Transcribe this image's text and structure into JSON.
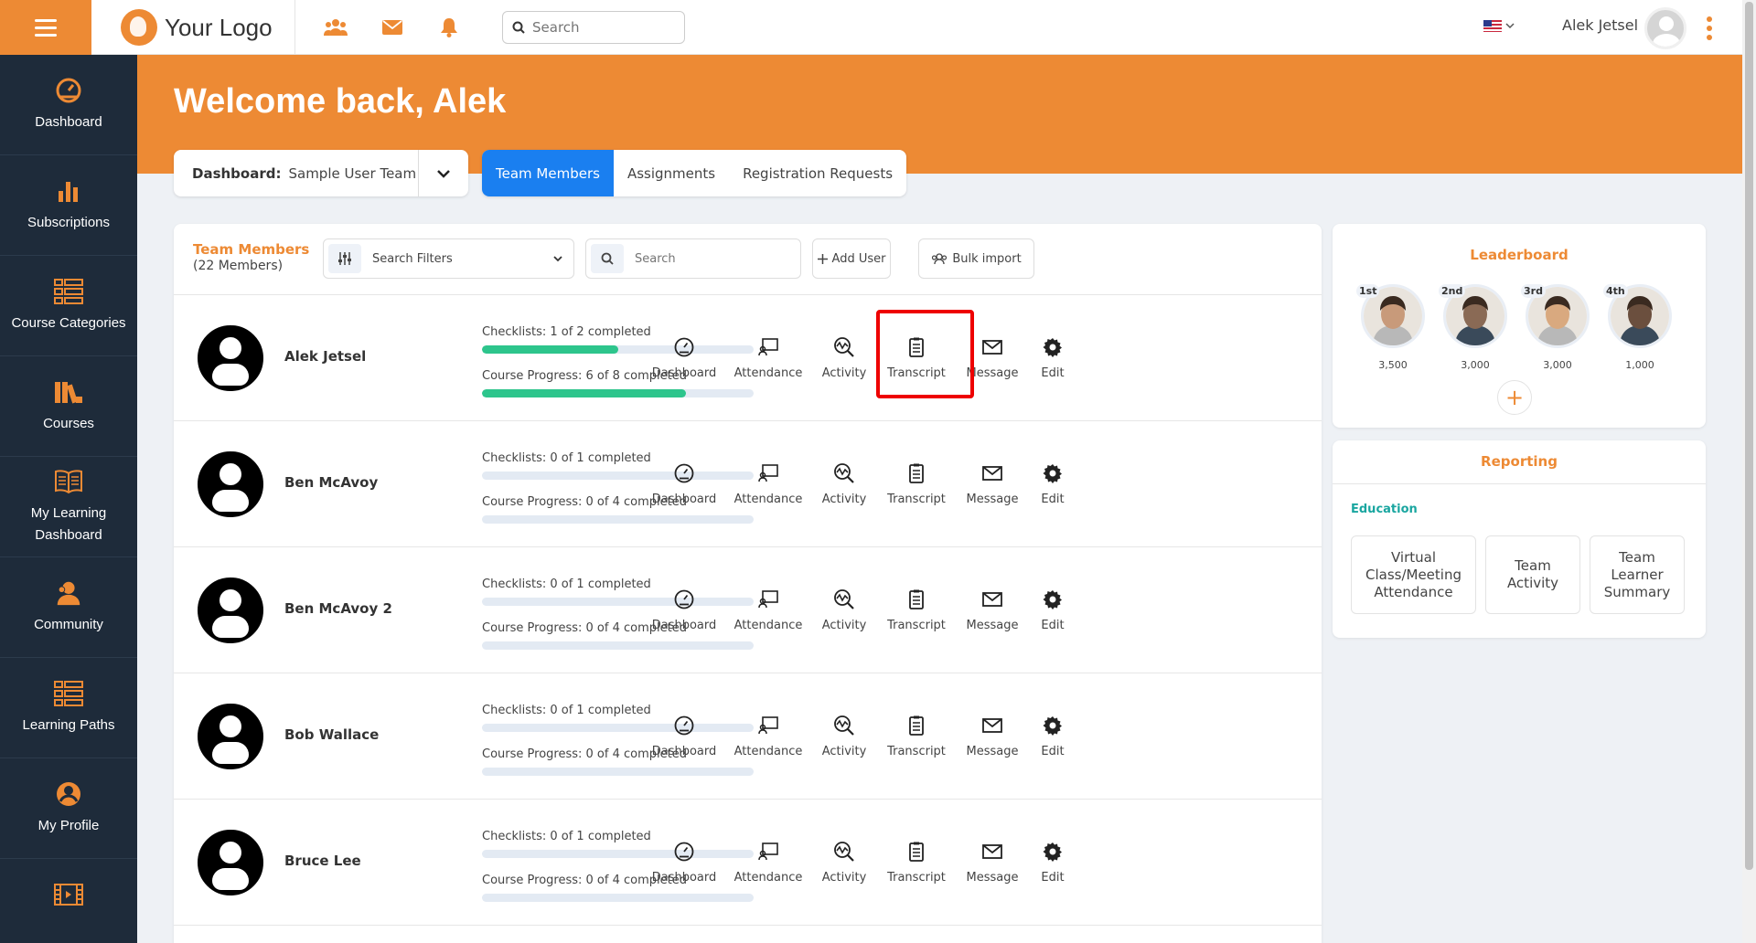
{
  "topbar": {
    "logo_text": "Your Logo",
    "search_placeholder": "Search",
    "user_name": "Alek Jetsel"
  },
  "sidebar": {
    "items": [
      {
        "label": "Dashboard",
        "icon": "gauge-icon"
      },
      {
        "label": "Subscriptions",
        "icon": "bar-chart-icon"
      },
      {
        "label": "Course Categories",
        "icon": "list-icon"
      },
      {
        "label": "Courses",
        "icon": "books-icon"
      },
      {
        "label": "My Learning Dashboard",
        "icon": "open-book-icon"
      },
      {
        "label": "Community",
        "icon": "users-icon"
      },
      {
        "label": "Learning Paths",
        "icon": "list-icon"
      },
      {
        "label": "My Profile",
        "icon": "user-circle-icon"
      },
      {
        "label": "",
        "icon": "film-icon"
      }
    ]
  },
  "hero": {
    "title": "Welcome back, Alek"
  },
  "dashboard_select": {
    "label": "Dashboard:",
    "value": "Sample User Team"
  },
  "tabs": [
    {
      "label": "Team Members",
      "active": true
    },
    {
      "label": "Assignments",
      "active": false
    },
    {
      "label": "Registration Requests",
      "active": false
    }
  ],
  "team_panel": {
    "title": "Team Members",
    "count": "(22 Members)",
    "filter_label": "Search Filters",
    "search_placeholder": "Search",
    "add_user": "Add User",
    "bulk_import": "Bulk import"
  },
  "actions": [
    "Dashboard",
    "Attendance",
    "Activity",
    "Transcript",
    "Message",
    "Edit"
  ],
  "members": [
    {
      "name": "Alek Jetsel",
      "checklists": "Checklists: 1 of 2 completed",
      "checklist_progress": 0.5,
      "course": "Course Progress: 6 of 8 completed",
      "course_progress": 0.75
    },
    {
      "name": "Ben McAvoy",
      "checklists": "Checklists: 0 of 1 completed",
      "checklist_progress": 0,
      "course": "Course Progress: 0 of 4 completed",
      "course_progress": 0
    },
    {
      "name": "Ben McAvoy 2",
      "checklists": "Checklists: 0 of 1 completed",
      "checklist_progress": 0,
      "course": "Course Progress: 0 of 4 completed",
      "course_progress": 0
    },
    {
      "name": "Bob Wallace",
      "checklists": "Checklists: 0 of 1 completed",
      "checklist_progress": 0,
      "course": "Course Progress: 0 of 4 completed",
      "course_progress": 0
    },
    {
      "name": "Bruce Lee",
      "checklists": "Checklists: 0 of 1 completed",
      "checklist_progress": 0,
      "course": "Course Progress: 0 of 4 completed",
      "course_progress": 0
    }
  ],
  "leaderboard": {
    "title": "Leaderboard",
    "entries": [
      {
        "rank": "1st",
        "score": "3,500",
        "color": "#c89a7a"
      },
      {
        "rank": "2nd",
        "score": "3,000",
        "color": "#8a6a55"
      },
      {
        "rank": "3rd",
        "score": "3,000",
        "color": "#d9a97f"
      },
      {
        "rank": "4th",
        "score": "1,000",
        "color": "#6b4f3e"
      }
    ],
    "add_symbol": "+"
  },
  "reporting": {
    "title": "Reporting",
    "section": "Education",
    "cards": [
      "Virtual Class/Meeting Attendance",
      "Team Activity",
      "Team Learner Summary"
    ]
  },
  "colors": {
    "accent": "#ed8a34",
    "sidebar": "#1e2b3a",
    "active_tab": "#1a7ff0",
    "progress": "#2dc58c",
    "highlight": "#ee0000"
  }
}
